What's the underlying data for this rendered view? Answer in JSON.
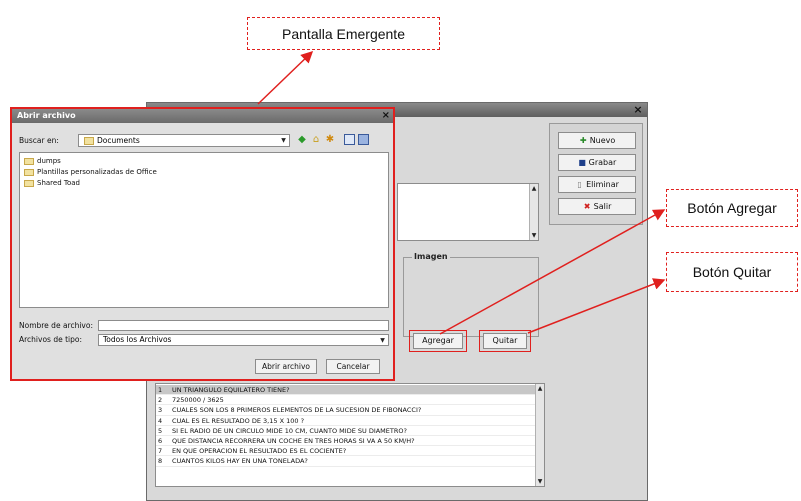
{
  "callouts": {
    "popup": "Pantalla Emergente",
    "add": "Botón Agregar",
    "remove": "Botón Quitar"
  },
  "background_window": {
    "close_glyph": "×",
    "side_buttons": [
      {
        "label": "Nuevo",
        "icon": "new-icon"
      },
      {
        "label": "Grabar",
        "icon": "save-icon"
      },
      {
        "label": "Eliminar",
        "icon": "delete-icon"
      },
      {
        "label": "Salir",
        "icon": "exit-icon"
      }
    ],
    "image_group_label": "Imagen",
    "add_button": "Agregar",
    "remove_button": "Quitar",
    "questions": [
      {
        "num": "1",
        "text": "UN TRIANGULO EQUILATERO TIENE?"
      },
      {
        "num": "2",
        "text": "7250000 / 3625"
      },
      {
        "num": "3",
        "text": "CUALES SON LOS 8 PRIMEROS ELEMENTOS DE LA SUCESION DE FIBONACCI?"
      },
      {
        "num": "4",
        "text": "CUAL ES EL RESULTADO DE 3,15 X 100 ?"
      },
      {
        "num": "5",
        "text": "SI EL RADIO DE UN CIRCULO MIDE 10 CM, CUANTO MIDE SU DIAMETRO?"
      },
      {
        "num": "6",
        "text": "QUE DISTANCIA RECORRERA UN COCHE EN TRES HORAS SI VA A 50 KM/H?"
      },
      {
        "num": "7",
        "text": "EN QUE OPERACION EL RESULTADO ES EL COCIENTE?"
      },
      {
        "num": "8",
        "text": "CUANTOS KILOS HAY EN UNA TONELADA?"
      }
    ]
  },
  "dialog": {
    "title": "Abrir archivo",
    "close_glyph": "×",
    "look_in_label": "Buscar en:",
    "look_in_value": "Documents",
    "folders": [
      "dumps",
      "Plantillas personalizadas de Office",
      "Shared Toad"
    ],
    "filename_label": "Nombre de archivo:",
    "filename_value": "",
    "filetype_label": "Archivos de tipo:",
    "filetype_value": "Todos los Archivos",
    "open_button": "Abrir archivo",
    "cancel_button": "Cancelar"
  },
  "colors": {
    "highlight_red": "#e0201e",
    "titlebar_gray": "#6a6a6a"
  }
}
